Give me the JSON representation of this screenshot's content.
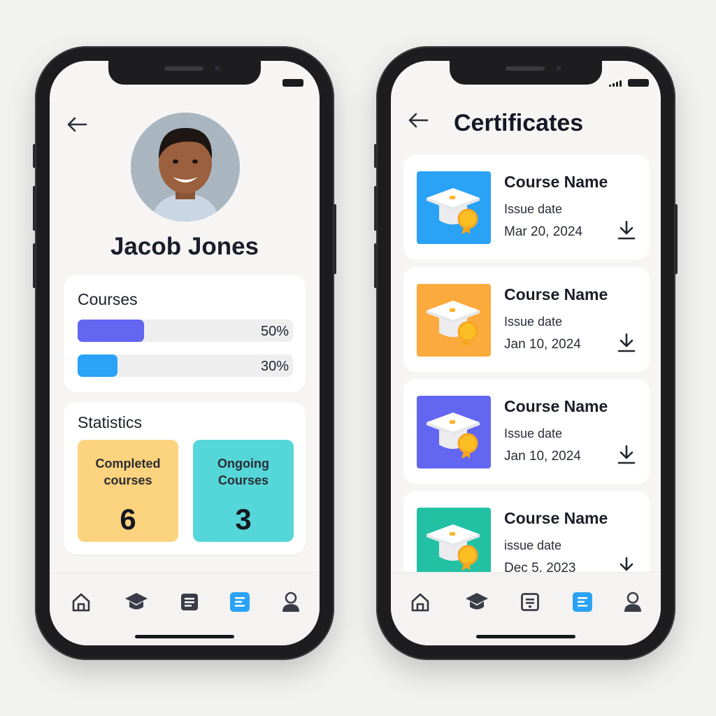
{
  "profile_screen": {
    "name": "Jacob Jones",
    "courses": {
      "title": "Courses",
      "progress": [
        {
          "label": "50%",
          "value": 0.5,
          "color": "#6366f1"
        },
        {
          "label": "30%",
          "value": 0.3,
          "color": "#2aa2f5"
        }
      ]
    },
    "statistics": {
      "title": "Statistics",
      "completed": {
        "label_line1": "Completed",
        "label_line2": "courses",
        "value": "6",
        "color": "#fcd37e"
      },
      "ongoing": {
        "label_line1": "Ongoing",
        "label_line2": "Courses",
        "value": "3",
        "color": "#55d6d9"
      }
    }
  },
  "certificates_screen": {
    "title": "Certificates",
    "items": [
      {
        "name": "Course Name",
        "issue_label": "Issue date",
        "date": "Mar 20, 2024",
        "color": "#2aa2f5"
      },
      {
        "name": "Course Name",
        "issue_label": "Issue date",
        "date": "Jan 10, 2024",
        "color": "#fbaa3e"
      },
      {
        "name": "Course Name",
        "issue_label": "Issue date",
        "date": "Jan 10, 2024",
        "color": "#6366f1"
      },
      {
        "name": "Course Name",
        "issue_label": "issue date",
        "date": "Dec 5, 2023",
        "color": "#23c1a4"
      }
    ]
  },
  "bottom_nav": {
    "items": [
      "home-icon",
      "graduation-cap-icon",
      "document-icon",
      "certificate-list-icon",
      "profile-icon"
    ],
    "active_index": 3,
    "active_color": "#2aa2f5"
  }
}
